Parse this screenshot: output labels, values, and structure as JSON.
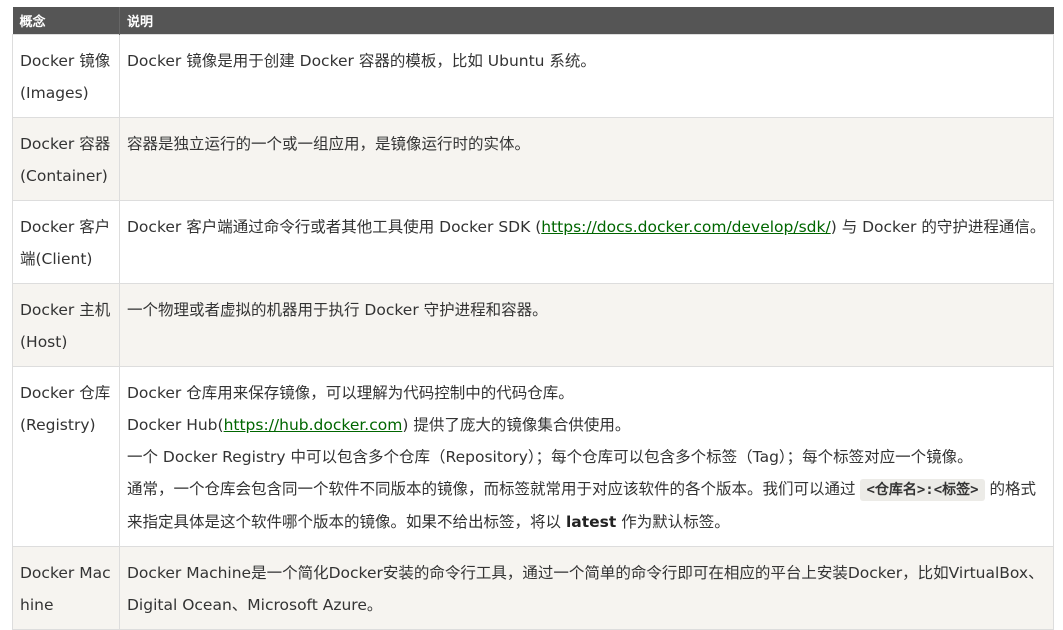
{
  "header": {
    "col1": "概念",
    "col2": "说明"
  },
  "rows": [
    {
      "concept": "Docker 镜像(Images)",
      "desc": "Docker 镜像是用于创建 Docker 容器的模板，比如 Ubuntu 系统。"
    },
    {
      "concept": "Docker 容器(Container)",
      "desc": "容器是独立运行的一个或一组应用，是镜像运行时的实体。"
    },
    {
      "concept": "Docker 客户端(Client)",
      "desc_pre": "Docker 客户端通过命令行或者其他工具使用 Docker SDK (",
      "link": "https://docs.docker.com/develop/sdk/",
      "desc_post": ") 与 Docker 的守护进程通信。"
    },
    {
      "concept": "Docker 主机(Host)",
      "desc": "一个物理或者虚拟的机器用于执行 Docker 守护进程和容器。"
    },
    {
      "concept": "Docker 仓库(Registry)",
      "line1": "Docker 仓库用来保存镜像，可以理解为代码控制中的代码仓库。",
      "line2_pre": "Docker Hub(",
      "line2_link": "https://hub.docker.com",
      "line2_post": ") 提供了庞大的镜像集合供使用。",
      "line3": "一个 Docker Registry 中可以包含多个仓库（Repository）；每个仓库可以包含多个标签（Tag）；每个标签对应一个镜像。",
      "line4_pre": "通常，一个仓库会包含同一个软件不同版本的镜像，而标签就常用于对应该软件的各个版本。我们可以通过 ",
      "line4_code": "<仓库名>:<标签>",
      "line4_post": " 的格式来指定具体是这个软件哪个版本的镜像。如果不给出标签，将以 ",
      "line4_bold": "latest",
      "line4_end": " 作为默认标签。"
    },
    {
      "concept": "Docker Machine",
      "desc": "Docker Machine是一个简化Docker安装的命令行工具，通过一个简单的命令行即可在相应的平台上安装Docker，比如VirtualBox、 Digital Ocean、Microsoft Azure。"
    }
  ]
}
